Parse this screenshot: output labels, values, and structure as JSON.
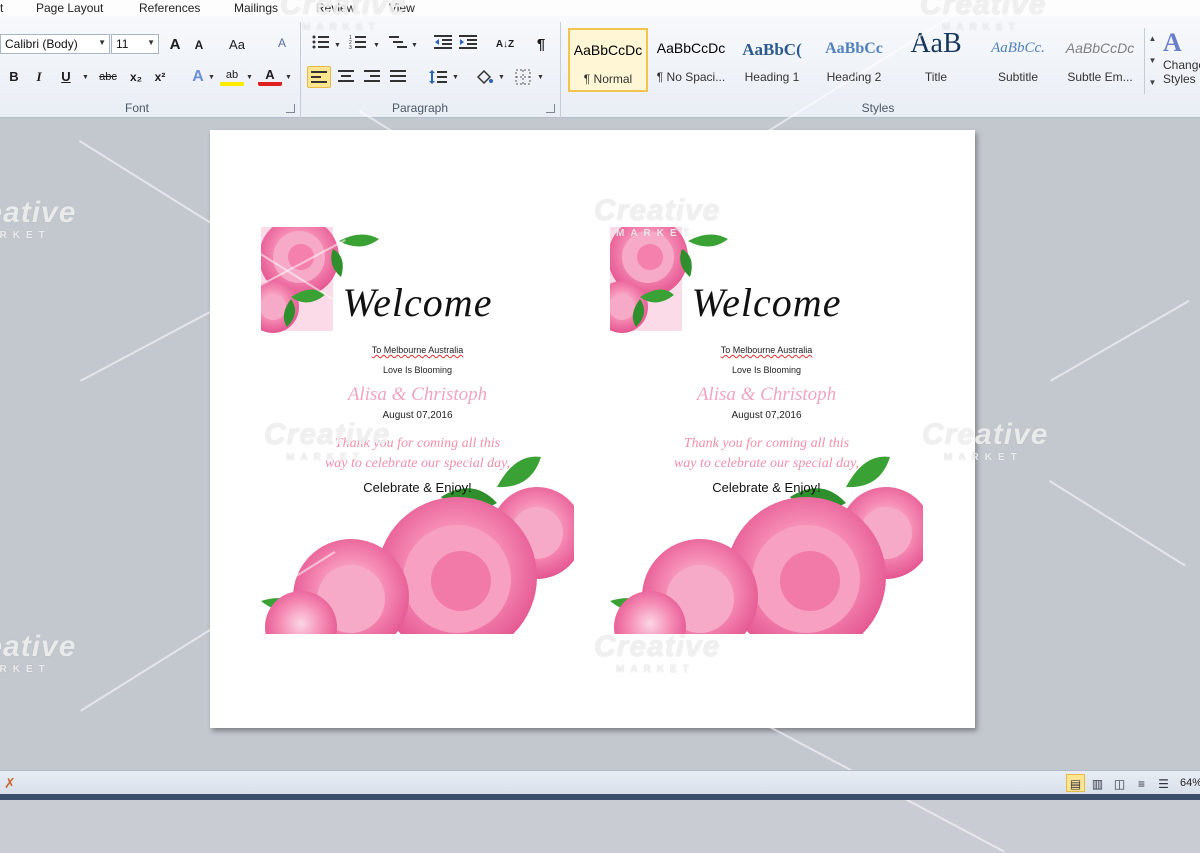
{
  "menu": {
    "items": [
      "t",
      "Page Layout",
      "References",
      "Mailings",
      "Review",
      "View"
    ]
  },
  "font_group": {
    "label": "Font",
    "font_name": "Calibri (Body)",
    "font_size": "11",
    "buttons": {
      "grow": "A",
      "shrink": "A",
      "change_case": "Aa",
      "clear": "A",
      "bold": "B",
      "italic": "I",
      "underline": "U",
      "strike": "abc",
      "subscript": "x₂",
      "superscript": "x²",
      "text_effects": "A",
      "highlight": "ab",
      "font_color": "A"
    }
  },
  "paragraph_group": {
    "label": "Paragraph",
    "show_marks": "¶",
    "sort": "A↓Z"
  },
  "styles_group": {
    "label": "Styles",
    "styles": [
      {
        "sample": "AaBbCcDc",
        "name": "¶ Normal",
        "color": "#111111",
        "selected": true
      },
      {
        "sample": "AaBbCcDc",
        "name": "¶ No Spaci...",
        "color": "#111111"
      },
      {
        "sample": "AaBbC(",
        "name": "Heading 1",
        "color": "#2d5a8c"
      },
      {
        "sample": "AaBbCc",
        "name": "Heading 2",
        "color": "#4f81bd"
      },
      {
        "sample": "AaB",
        "name": "Title",
        "color": "#17365d"
      },
      {
        "sample": "AaBbCc.",
        "name": "Subtitle",
        "color": "#4f81bd"
      },
      {
        "sample": "AaBbCcDc",
        "name": "Subtle Em...",
        "color": "#808080"
      }
    ],
    "change_styles": {
      "icon": "A",
      "label": "Change Styles"
    }
  },
  "document": {
    "cards": [
      {
        "welcome": "Welcome",
        "to_line": "To Melbourne Australia",
        "tagline": "Love Is Blooming",
        "couple": "Alisa & Christoph",
        "date": "August 07,2016",
        "thanks_line1": "Thank you for coming all this",
        "thanks_line2": "way to celebrate our special day,",
        "closing": "Celebrate & Enjoy!"
      },
      {
        "welcome": "Welcome",
        "to_line": "To Melbourne Australia",
        "tagline": "Love Is Blooming",
        "couple": "Alisa & Christoph",
        "date": "August 07,2016",
        "thanks_line1": "Thank you for coming all this",
        "thanks_line2": "way to celebrate our special day,",
        "closing": "Celebrate & Enjoy!"
      }
    ]
  },
  "statusbar": {
    "zoom": "64%"
  },
  "watermark": {
    "text": "Creative",
    "sub": "MARKET"
  },
  "colors": {
    "rose_pink": "#f06fa0",
    "rose_light": "#fbc6da",
    "leaf_green": "#3aa135",
    "couple_text": "#f0a5bd",
    "selection_gold": "#f0c44f"
  }
}
